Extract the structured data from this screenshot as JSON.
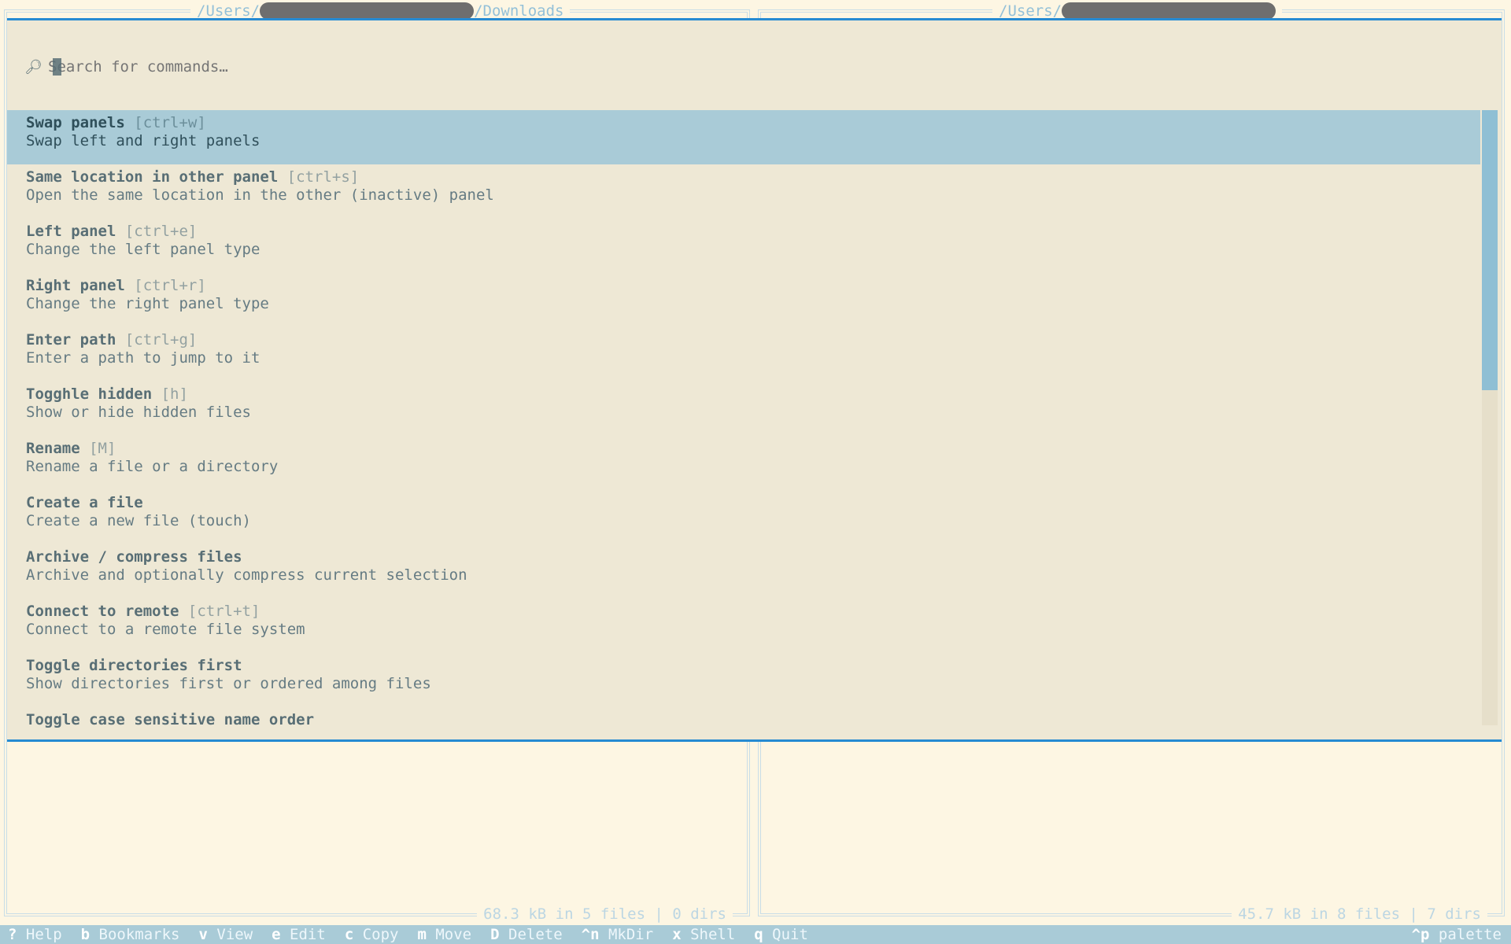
{
  "panels": {
    "left": {
      "path_prefix": "/Users/",
      "path_suffix": "/Downloads",
      "footer": "68.3 kB in 5 files | 0 dirs"
    },
    "right": {
      "path_prefix": "/Users/",
      "path_suffix": "",
      "footer": "45.7 kB in 8 files | 7 dirs"
    }
  },
  "palette": {
    "search_placeholder": "Search for commands…",
    "search_icon": "magnifier-icon",
    "commands": [
      {
        "title": "Swap panels",
        "key": "[ctrl+w]",
        "desc": "Swap left and right panels"
      },
      {
        "title": "Same location in other panel",
        "key": "[ctrl+s]",
        "desc": "Open the same location in the other (inactive) panel"
      },
      {
        "title": "Left panel",
        "key": "[ctrl+e]",
        "desc": "Change the left panel type"
      },
      {
        "title": "Right panel",
        "key": "[ctrl+r]",
        "desc": "Change the right panel type"
      },
      {
        "title": "Enter path",
        "key": "[ctrl+g]",
        "desc": "Enter a path to jump to it"
      },
      {
        "title": "Togghle hidden",
        "key": "[h]",
        "desc": "Show or hide hidden files"
      },
      {
        "title": "Rename",
        "key": "[M]",
        "desc": "Rename a file or a directory"
      },
      {
        "title": "Create a file",
        "key": "",
        "desc": "Create a new file (touch)"
      },
      {
        "title": "Archive / compress files",
        "key": "",
        "desc": "Archive and optionally compress current selection"
      },
      {
        "title": "Connect to remote",
        "key": "[ctrl+t]",
        "desc": "Connect to a remote file system"
      },
      {
        "title": "Toggle directories first",
        "key": "",
        "desc": "Show directories first or ordered among files"
      },
      {
        "title": "Toggle case sensitive name order",
        "key": "",
        "desc": ""
      }
    ]
  },
  "bottom_bar": {
    "shortcuts": [
      {
        "key": "?",
        "label": "Help"
      },
      {
        "key": "b",
        "label": "Bookmarks"
      },
      {
        "key": "v",
        "label": "View"
      },
      {
        "key": "e",
        "label": "Edit"
      },
      {
        "key": "c",
        "label": "Copy"
      },
      {
        "key": "m",
        "label": "Move"
      },
      {
        "key": "D",
        "label": "Delete"
      },
      {
        "key": "^n",
        "label": "MkDir"
      },
      {
        "key": "x",
        "label": "Shell"
      },
      {
        "key": "q",
        "label": "Quit"
      }
    ],
    "palette_key": "^p",
    "palette_label": "palette"
  },
  "colors": {
    "background": "#fdf6e3",
    "palette_bg": "#eee8d5",
    "accent": "#268bd2",
    "selection": "#a9cbd7"
  }
}
